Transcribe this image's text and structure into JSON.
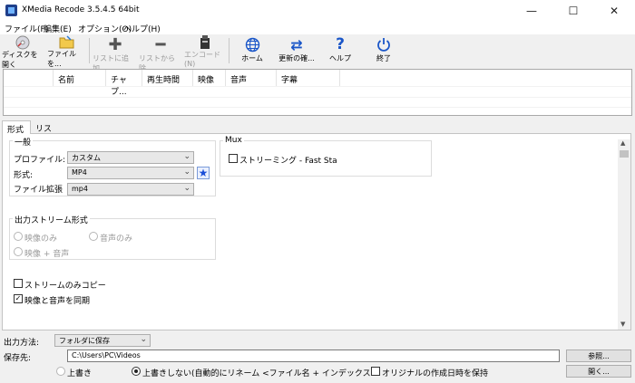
{
  "window": {
    "title": "XMedia Recode 3.5.4.5 64bit",
    "controls": {
      "minimize": "—",
      "maximize": "☐",
      "close": "✕"
    }
  },
  "menu": [
    "ファイル(F)",
    "編集(E)",
    "オプション(O)",
    "ヘルプ(H)"
  ],
  "toolbar": {
    "open_disc": "ディスクを開く",
    "open_file": "ファイルを...",
    "add_to_list": "リストに追加...",
    "remove_from_list": "リストから除...",
    "encode": "エンコード(N)",
    "home": "ホーム",
    "check_updates": "更新の確...",
    "help": "ヘルプ",
    "exit": "終了"
  },
  "file_list": {
    "columns": [
      "名前",
      "チャプ...",
      "再生時間",
      "映像",
      "音声",
      "字幕"
    ]
  },
  "tabs": [
    "形式",
    "リスト"
  ],
  "general": {
    "title": "一般",
    "profile_label": "プロファイル:",
    "profile_value": "カスタム",
    "format_label": "形式:",
    "format_value": "MP4",
    "ext_label": "ファイル拡張子:",
    "ext_value": "mp4"
  },
  "mux": {
    "title": "Mux",
    "streaming_label": "ストリーミング - Fast Sta"
  },
  "output_stream": {
    "title": "出力ストリーム形式",
    "video_only": "映像のみ",
    "audio_only": "音声のみ",
    "video_audio": "映像 + 音声"
  },
  "options": {
    "stream_copy_only": "ストリームのみコピー",
    "sync_av": "映像と音声を同期",
    "sync_av_checked": true
  },
  "output": {
    "method_label": "出力方法:",
    "method_value": "フォルダに保存",
    "dest_label": "保存先:",
    "dest_value": "C:\\Users\\PC\\Videos",
    "browse": "参照...",
    "open": "開く...",
    "overwrite": "上書き",
    "no_overwrite": "上書きしない(自動的にリネーム <ファイル名 + インデックス>",
    "keep_date": "オリジナルの作成日時を保持"
  },
  "colors": {
    "accent": "#1a56c8",
    "star": "#1b4fd8"
  }
}
